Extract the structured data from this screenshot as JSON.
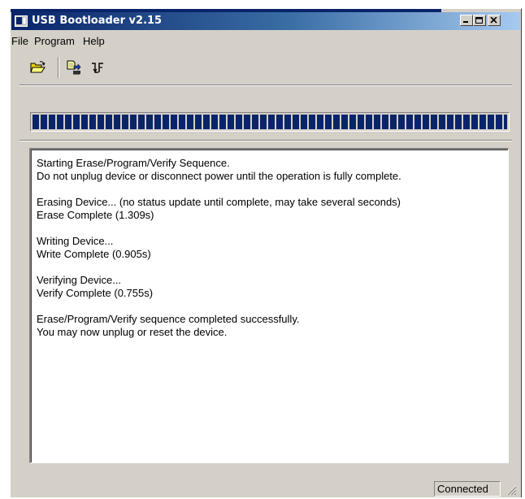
{
  "window": {
    "title": "USB Bootloader v2.15",
    "icon": "app-icon"
  },
  "caption_buttons": [
    "minimize-icon",
    "maximize-icon",
    "close-icon"
  ],
  "menu": {
    "items": [
      {
        "label": "File"
      },
      {
        "label": "Program"
      },
      {
        "label": "Help"
      }
    ]
  },
  "toolbar": {
    "buttons": [
      {
        "icon": "open-folder-icon"
      },
      {
        "icon": "erase-program-verify-icon"
      },
      {
        "icon": "reset-device-icon"
      }
    ]
  },
  "progress": {
    "percent": 100,
    "color": "#0a246a"
  },
  "log": {
    "lines": [
      "Starting Erase/Program/Verify Sequence.",
      "Do not unplug device or disconnect power until the operation is fully complete.",
      "",
      "Erasing Device... (no status update until complete, may take several seconds)",
      "Erase Complete (1.309s)",
      "",
      "Writing Device...",
      "Write Complete (0.905s)",
      "",
      "Verifying Device...",
      "Verify Complete (0.755s)",
      "",
      "Erase/Program/Verify sequence completed successfully.",
      "You may now unplug or reset the device."
    ]
  },
  "status": {
    "connection": "Connected",
    "grip_icon": "resize-grip-icon"
  },
  "colors": {
    "titlebar_start": "#0a246a",
    "titlebar_end": "#a6caf0",
    "face": "#d4d0c8"
  }
}
